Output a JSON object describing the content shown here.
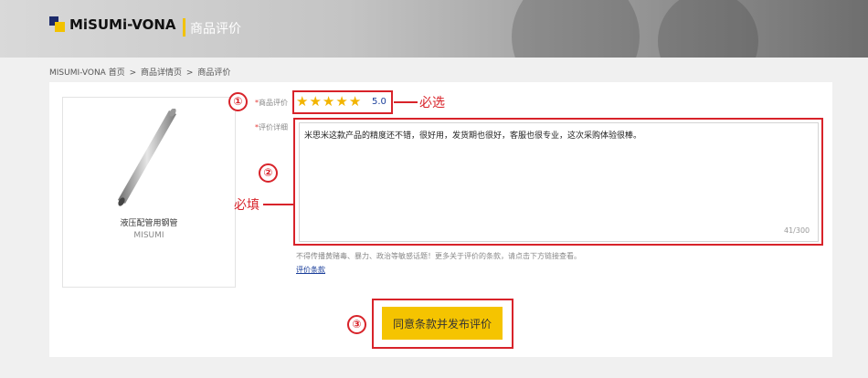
{
  "header": {
    "logo_text": "MiSUMi-VONA",
    "title": "商品评价"
  },
  "breadcrumb": [
    "MISUMI-VONA 首页",
    ">",
    "商品详情页",
    ">",
    "商品评价"
  ],
  "product": {
    "name": "液压配管用钢管",
    "brand": "MISUMI"
  },
  "form": {
    "rating_label_req": "*",
    "rating_label": "商品评价",
    "rating_value": "5.0",
    "rating_stars": 5,
    "detail_label_req": "*",
    "detail_label": "评价详细",
    "review_text": "米思米这款产品的精度还不错，很好用，发货期也很好，客服也很专业，这次采购体验很棒。",
    "char_count": "41/300",
    "note": "不得传播黄赌毒、暴力、政治等敏感话题！更多关于评价的条款，请点击下方链接查看。",
    "terms_link": "评价条款",
    "submit_label": "同意条款并发布评价"
  },
  "annotations": {
    "num1": "①",
    "text1": "必选",
    "num2": "②",
    "text2": "必填",
    "num3": "③"
  },
  "colors": {
    "accent": "#f5c400",
    "annotation_red": "#d8232a",
    "link_blue": "#1a3e9a"
  }
}
